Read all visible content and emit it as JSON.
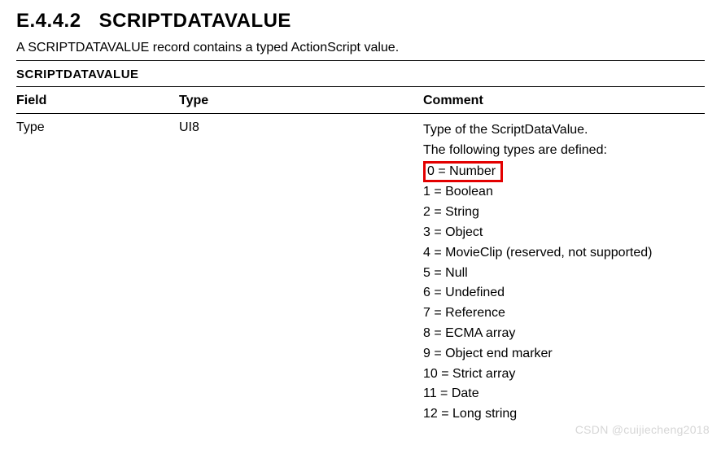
{
  "heading": {
    "number": "E.4.4.2",
    "title": "SCRIPTDATAVALUE"
  },
  "intro": "A SCRIPTDATAVALUE record contains a typed ActionScript value.",
  "table": {
    "title": "SCRIPTDATAVALUE",
    "headers": {
      "field": "Field",
      "type": "Type",
      "comment": "Comment"
    },
    "row": {
      "field": "Type",
      "type": "UI8",
      "comment_intro1": "Type of the ScriptDataValue.",
      "comment_intro2": "The following types are defined:",
      "types": [
        {
          "text": "0 = Number",
          "highlight": true
        },
        {
          "text": "1 = Boolean"
        },
        {
          "text": "2 = String"
        },
        {
          "text": "3 = Object"
        },
        {
          "text": "4 = MovieClip (reserved, not supported)"
        },
        {
          "text": "5 = Null"
        },
        {
          "text": "6 = Undefined"
        },
        {
          "text": "7 = Reference"
        },
        {
          "text": "8 = ECMA array"
        },
        {
          "text": "9 = Object end marker"
        },
        {
          "text": "10 = Strict array"
        },
        {
          "text": "11 = Date"
        },
        {
          "text": "12 = Long string"
        }
      ]
    }
  },
  "watermark": "CSDN @cuijiecheng2018"
}
